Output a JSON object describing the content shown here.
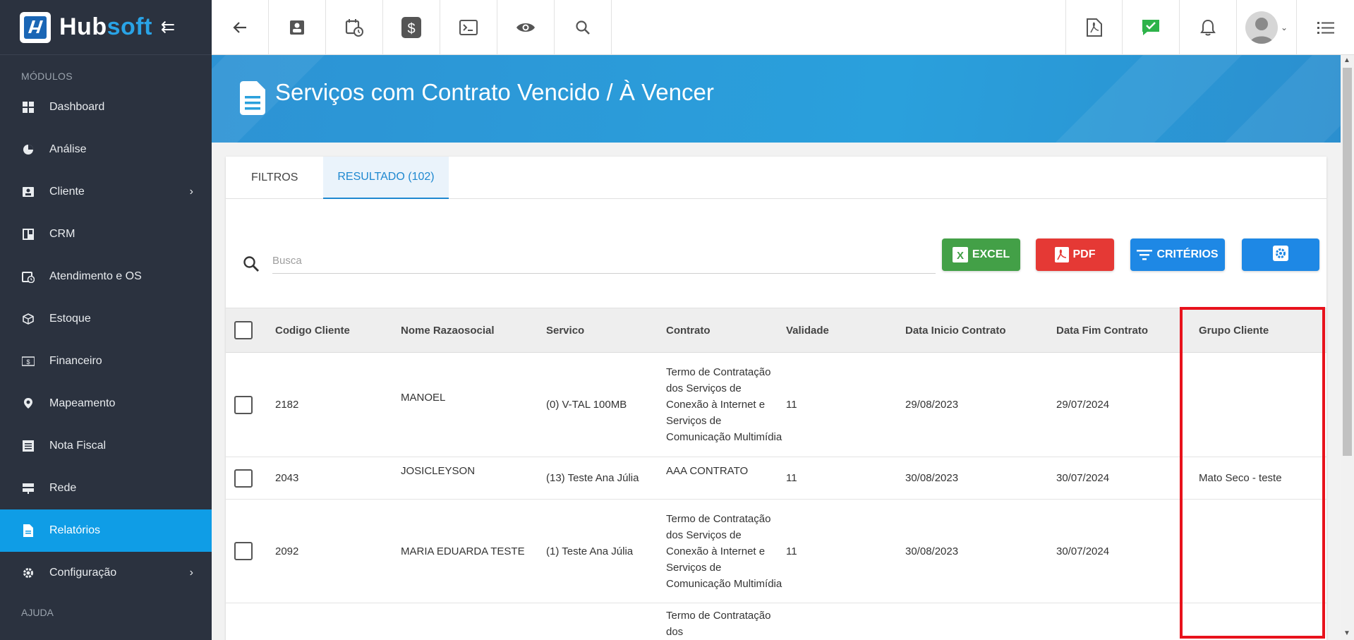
{
  "sidebar": {
    "logo": {
      "hub": "Hub",
      "soft": "soft"
    },
    "section_label": "MÓDULOS",
    "items": [
      {
        "label": "Dashboard",
        "icon": "dashboard-icon"
      },
      {
        "label": "Análise",
        "icon": "pie-chart-icon"
      },
      {
        "label": "Cliente",
        "icon": "contact-card-icon",
        "has_submenu": true
      },
      {
        "label": "CRM",
        "icon": "crm-board-icon"
      },
      {
        "label": "Atendimento e OS",
        "icon": "calendar-clock-icon"
      },
      {
        "label": "Estoque",
        "icon": "box-icon"
      },
      {
        "label": "Financeiro",
        "icon": "money-icon"
      },
      {
        "label": "Mapeamento",
        "icon": "map-pin-icon"
      },
      {
        "label": "Nota Fiscal",
        "icon": "invoice-icon"
      },
      {
        "label": "Rede",
        "icon": "network-icon"
      },
      {
        "label": "Relatórios",
        "icon": "report-icon",
        "active": true
      },
      {
        "label": "Configuração",
        "icon": "gear-icon",
        "has_submenu": true
      }
    ],
    "help_label": "AJUDA"
  },
  "page": {
    "title": "Serviços com Contrato Vencido / À Vencer"
  },
  "tabs": [
    {
      "label": "FILTROS"
    },
    {
      "label": "RESULTADO (102)",
      "active": true
    }
  ],
  "search": {
    "placeholder": "Busca",
    "value": ""
  },
  "actions": {
    "excel": "EXCEL",
    "pdf": "PDF",
    "criteria": "CRITÉRIOS"
  },
  "table": {
    "headers": [
      "Codigo Cliente",
      "Nome Razaosocial",
      "Servico",
      "Contrato",
      "Validade",
      "Data Inicio Contrato",
      "Data Fim Contrato",
      "Grupo Cliente"
    ],
    "rows": [
      {
        "codigo": "2182",
        "nome": "MANOEL",
        "servico": "(0) V-TAL 100MB",
        "contrato": "Termo de Contratação dos Serviços de Conexão à Internet e Serviços de Comunicação Multimídia",
        "validade": "11",
        "inicio": "29/08/2023",
        "fim": "29/07/2024",
        "grupo": ""
      },
      {
        "codigo": "2043",
        "nome": "JOSICLEYSON",
        "servico": "(13) Teste Ana Júlia",
        "contrato": "AAA CONTRATO",
        "validade": "11",
        "inicio": "30/08/2023",
        "fim": "30/07/2024",
        "grupo": "Mato Seco - teste"
      },
      {
        "codigo": "2092",
        "nome": "MARIA EDUARDA TESTE",
        "servico": "(1) Teste Ana Júlia",
        "contrato": "Termo de Contratação dos Serviços de Conexão à Internet e Serviços de Comunicação Multimídia",
        "validade": "11",
        "inicio": "30/08/2023",
        "fim": "30/07/2024",
        "grupo": ""
      },
      {
        "codigo": "",
        "nome": "",
        "servico": "",
        "contrato": "Termo de Contratação dos",
        "validade": "",
        "inicio": "",
        "fim": "",
        "grupo": ""
      }
    ]
  },
  "colors": {
    "sidebar_bg": "#2b323f",
    "active_item": "#0f9de6",
    "banner": "#2aa0dc",
    "excel": "#43a047",
    "pdf": "#e53935",
    "primary": "#1e88e5",
    "highlight": "#e8121c"
  }
}
